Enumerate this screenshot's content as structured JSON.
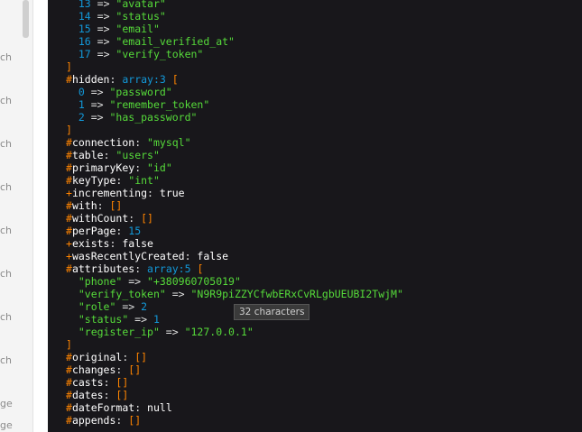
{
  "sidebar": {
    "fragments": [
      "ch",
      "ch",
      "ch",
      "ch",
      "ch",
      "ch",
      "ch",
      "ch",
      "ge",
      "ge"
    ]
  },
  "code": {
    "top_list": [
      {
        "idx": "13",
        "val": "\"avatar\""
      },
      {
        "idx": "14",
        "val": "\"status\""
      },
      {
        "idx": "15",
        "val": "\"email\""
      },
      {
        "idx": "16",
        "val": "\"email_verified_at\""
      },
      {
        "idx": "17",
        "val": "\"verify_token\""
      }
    ],
    "close_bracket": "]",
    "hidden": {
      "key": "hidden",
      "type": "array:3",
      "open": "["
    },
    "hidden_items": [
      {
        "idx": "0",
        "val": "\"password\""
      },
      {
        "idx": "1",
        "val": "\"remember_token\""
      },
      {
        "idx": "2",
        "val": "\"has_password\""
      }
    ],
    "props1": [
      {
        "prefix": "#",
        "key": "connection",
        "val": "\"mysql\"",
        "cls": "s"
      },
      {
        "prefix": "#",
        "key": "table",
        "val": "\"users\"",
        "cls": "s"
      },
      {
        "prefix": "#",
        "key": "primaryKey",
        "val": "\"id\"",
        "cls": "s"
      },
      {
        "prefix": "#",
        "key": "keyType",
        "val": "\"int\"",
        "cls": "s"
      },
      {
        "prefix": "+",
        "key": "incrementing",
        "val": "true",
        "cls": "k"
      },
      {
        "prefix": "#",
        "key": "with",
        "val": "[]",
        "cls": "br"
      },
      {
        "prefix": "#",
        "key": "withCount",
        "val": "[]",
        "cls": "br"
      },
      {
        "prefix": "#",
        "key": "perPage",
        "val": "15",
        "cls": "n"
      },
      {
        "prefix": "+",
        "key": "exists",
        "val": "false",
        "cls": "k"
      },
      {
        "prefix": "+",
        "key": "wasRecentlyCreated",
        "val": "false",
        "cls": "k"
      }
    ],
    "attributes": {
      "key": "attributes",
      "type": "array:5",
      "open": "["
    },
    "attr_items": [
      {
        "key": "\"phone\"",
        "val": "\"+380960705019\"",
        "cls": "s"
      },
      {
        "key": "\"verify_token\"",
        "val": "\"N9R9piZZYCfwbERxCvRLgbUEUBI2TwjM\"",
        "cls": "s"
      },
      {
        "key": "\"role\"",
        "val": "2",
        "cls": "n"
      },
      {
        "key": "\"status\"",
        "val": "1",
        "cls": "n"
      },
      {
        "key": "\"register_ip\"",
        "val": "\"127.0.0.1\"",
        "cls": "s"
      }
    ],
    "props2": [
      {
        "prefix": "#",
        "key": "original",
        "val": "[]",
        "cls": "br"
      },
      {
        "prefix": "#",
        "key": "changes",
        "val": "[]",
        "cls": "br"
      },
      {
        "prefix": "#",
        "key": "casts",
        "val": "[]",
        "cls": "br"
      },
      {
        "prefix": "#",
        "key": "dates",
        "val": "[]",
        "cls": "br"
      },
      {
        "prefix": "#",
        "key": "dateFormat",
        "val": "null",
        "cls": "k"
      },
      {
        "prefix": "#",
        "key": "appends",
        "val": "[]",
        "cls": "br"
      }
    ]
  },
  "tooltip": {
    "text": "32 characters"
  },
  "colors": {
    "panel_bg": "#18171b",
    "string": "#56db3a",
    "number": "#1299da",
    "symbol": "#ff8400"
  }
}
